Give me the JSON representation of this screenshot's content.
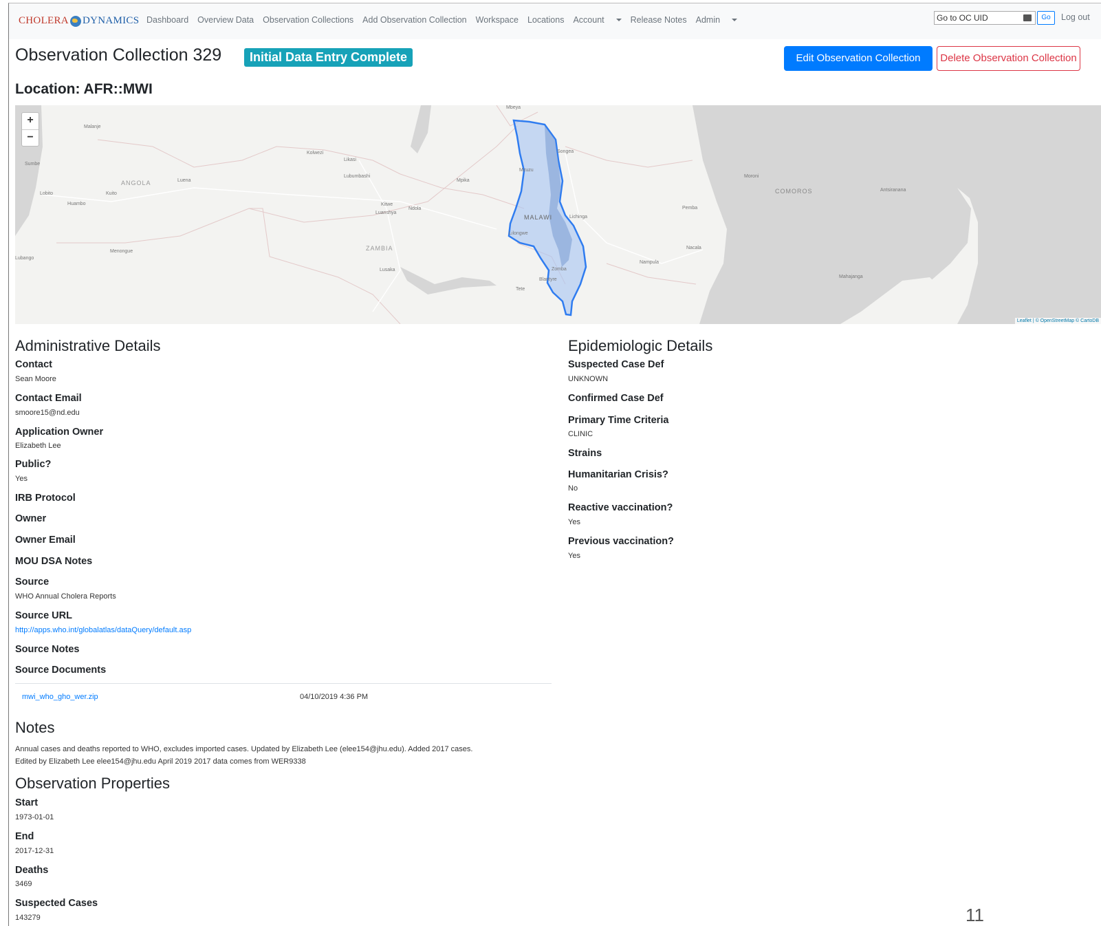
{
  "nav": {
    "brand_left": "CHOLERA",
    "brand_right": "DYNAMICS",
    "links": [
      "Dashboard",
      "Overview Data",
      "Observation Collections",
      "Add Observation Collection",
      "Workspace",
      "Locations",
      "Account",
      "Release Notes",
      "Admin"
    ],
    "oc_uid_value": "Go to OC UID",
    "go_label": "Go",
    "logout_label": "Log out"
  },
  "header": {
    "title": "Observation Collection 329",
    "status_badge": "Initial Data Entry Complete",
    "edit_label": "Edit Observation Collection",
    "delete_label": "Delete Observation Collection",
    "location": "Location: AFR::MWI",
    "colors": {
      "primary": "#007bff",
      "danger": "#dc3545",
      "badge": "#17a2b8"
    }
  },
  "map": {
    "zoom_in": "+",
    "zoom_out": "−",
    "attribution": "Leaflet | © OpenStreetMap © CartoDB",
    "countries": [
      "ANGOLA",
      "ZAMBIA",
      "MALAWI",
      "COMOROS"
    ],
    "cities": [
      "Malanje",
      "Luena",
      "Kolwezi",
      "Likasi",
      "Lubumbashi",
      "Mpika",
      "Mbeya",
      "Songea",
      "Mzuzu",
      "Kitwe",
      "Ndola",
      "Luanshya",
      "Lichinga",
      "Pemba",
      "Lobito",
      "Kuito",
      "Huambo",
      "Menongue",
      "Lusaka",
      "Lilongwe",
      "Nacala",
      "Nampula",
      "Zomba",
      "Blantyre",
      "Tete",
      "Moroni",
      "Antsiranana",
      "Mahajanga",
      "Sumbe",
      "Lubango"
    ],
    "highlight_color": "#2f7cf0"
  },
  "admin": {
    "heading": "Administrative Details",
    "contact_label": "Contact",
    "contact": "Sean Moore",
    "email_label": "Contact Email",
    "email": "smoore15@nd.edu",
    "app_owner_label": "Application Owner",
    "app_owner": "Elizabeth Lee",
    "public_label": "Public?",
    "public": "Yes",
    "irb_label": "IRB Protocol",
    "owner_label": "Owner",
    "owner_email_label": "Owner Email",
    "mou_label": "MOU DSA Notes",
    "source_label": "Source",
    "source": "WHO Annual Cholera Reports",
    "source_url_label": "Source URL",
    "source_url": "http://apps.who.int/globalatlas/dataQuery/default.asp",
    "source_notes_label": "Source Notes",
    "source_docs_label": "Source Documents",
    "doc_name": "mwi_who_gho_wer.zip",
    "doc_date": "04/10/2019 4:36 PM"
  },
  "epi": {
    "heading": "Epidemiologic Details",
    "suspected_label": "Suspected Case Def",
    "suspected": "UNKNOWN",
    "confirmed_label": "Confirmed Case Def",
    "time_label": "Primary Time Criteria",
    "time": "CLINIC",
    "strains_label": "Strains",
    "crisis_label": "Humanitarian Crisis?",
    "crisis": "No",
    "reactive_label": "Reactive vaccination?",
    "reactive": "Yes",
    "previous_label": "Previous vaccination?",
    "previous": "Yes"
  },
  "notes": {
    "heading": "Notes",
    "line1": "Annual cases and deaths reported to WHO, excludes imported cases. Updated by Elizabeth Lee (elee154@jhu.edu). Added 2017 cases.",
    "line2": "Edited by Elizabeth Lee elee154@jhu.edu April 2019 2017 data comes from WER9338"
  },
  "obs": {
    "heading": "Observation Properties",
    "start_label": "Start",
    "start": "1973-01-01",
    "end_label": "End",
    "end": "2017-12-31",
    "deaths_label": "Deaths",
    "deaths": "3469",
    "suspected_label": "Suspected Cases",
    "suspected": "143279"
  },
  "page_number": "11"
}
